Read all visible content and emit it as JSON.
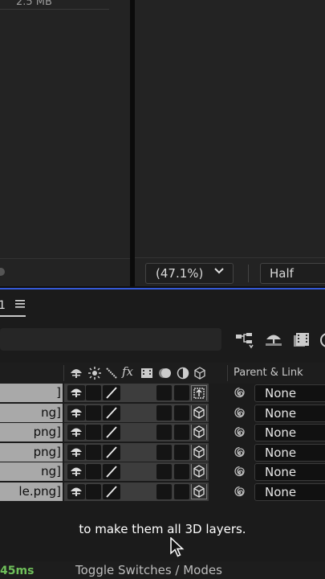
{
  "project_panel": {
    "file_size": "2.5 MB"
  },
  "viewer": {
    "zoom": "(47.1%)",
    "zoom_chevron": "❯",
    "resolution": "Half"
  },
  "timeline": {
    "tab_label": "1",
    "header": {
      "parent_link_label": "Parent & Link"
    },
    "layers": [
      {
        "name": "]",
        "parent": "None"
      },
      {
        "name": "ng]",
        "parent": "None"
      },
      {
        "name": "png]",
        "parent": "None"
      },
      {
        "name": "png]",
        "parent": "None"
      },
      {
        "name": "ng]",
        "parent": "None"
      },
      {
        "name": "le.png]",
        "parent": "None"
      }
    ]
  },
  "caption": "to make them all 3D layers.",
  "status_bar": {
    "render_time": "45ms",
    "toggle_label": "Toggle Switches / Modes"
  },
  "colors": {
    "accent_blue": "#3559d6",
    "render_time_green": "#6fbf5a"
  }
}
